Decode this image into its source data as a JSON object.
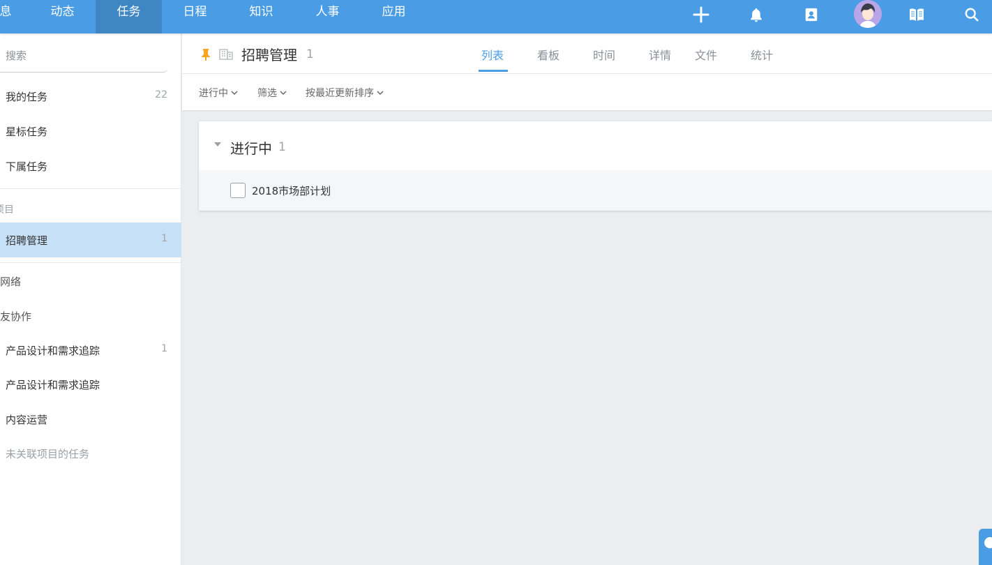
{
  "colors": {
    "brand": "#4a9de5",
    "nav_active": "#3f86c5",
    "sidebar_active": "#c6e1f7",
    "pin": "#f5a623"
  },
  "topnav": {
    "items": [
      "息",
      "动态",
      "任务",
      "日程",
      "知识",
      "人事",
      "应用"
    ],
    "active_index": 2,
    "icons": [
      "plus-icon",
      "bell-icon",
      "contacts-icon",
      "avatar",
      "book-icon",
      "search-icon"
    ]
  },
  "sidebar": {
    "search_placeholder": "搜索",
    "items": [
      {
        "label": "我的任务",
        "count": "22"
      },
      {
        "label": "星标任务",
        "count": ""
      },
      {
        "label": "下属任务",
        "count": ""
      }
    ],
    "projects_section": "项目",
    "active_project": {
      "label": "招聘管理",
      "count": "1"
    },
    "groups": [
      "网络",
      "友协作"
    ],
    "collab_items": [
      {
        "label": "产品设计和需求追踪",
        "count": "1"
      },
      {
        "label": "产品设计和需求追踪",
        "count": ""
      },
      {
        "label": "内容运营",
        "count": ""
      }
    ],
    "unlinked": "未关联项目的任务"
  },
  "header": {
    "title": "招聘管理",
    "count": "1",
    "tabs": [
      "列表",
      "看板",
      "时间",
      "详情",
      "文件",
      "统计"
    ],
    "active_tab": 0
  },
  "filters": [
    "进行中",
    "筛选",
    "按最近更新排序"
  ],
  "task_group": {
    "title": "进行中",
    "count": "1",
    "tasks": [
      {
        "title": "2018市场部计划",
        "done": false
      }
    ]
  }
}
